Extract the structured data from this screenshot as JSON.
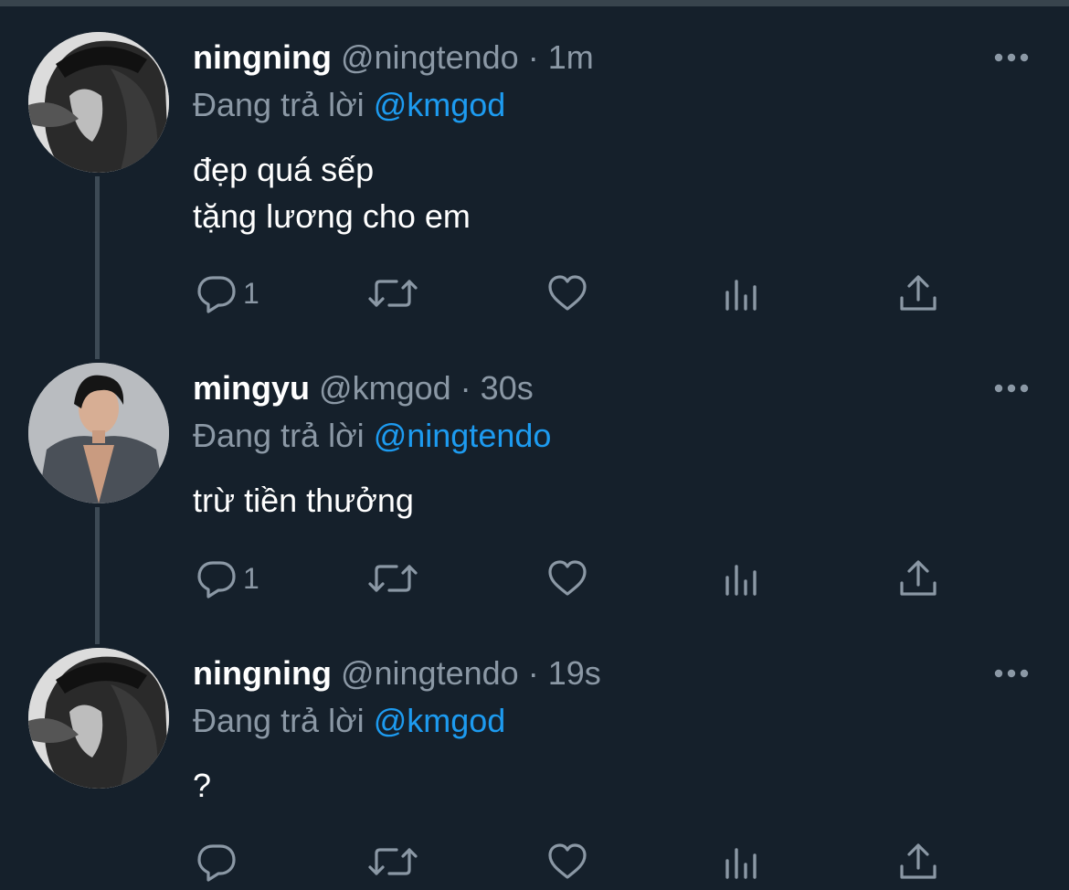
{
  "theme": {
    "background": "#15202b",
    "text": "#ffffff",
    "muted": "#8b98a5",
    "link": "#1d9bf0",
    "thread_line": "#3d4a55"
  },
  "tweets": [
    {
      "name": "ningning",
      "handle": "@ningtendo",
      "separator": "·",
      "time": "1m",
      "reply_prefix": "Đang trả lời",
      "reply_to": "@kmgod",
      "lines": [
        "đẹp quá sếp",
        "tặng lương cho em"
      ],
      "reply_count": "1",
      "avatar_icon": "user-avatar"
    },
    {
      "name": "mingyu",
      "handle": "@kmgod",
      "separator": "·",
      "time": "30s",
      "reply_prefix": "Đang trả lời",
      "reply_to": "@ningtendo",
      "lines": [
        "trừ tiền thưởng"
      ],
      "reply_count": "1",
      "avatar_icon": "user-avatar"
    },
    {
      "name": "ningning",
      "handle": "@ningtendo",
      "separator": "·",
      "time": "19s",
      "reply_prefix": "Đang trả lời",
      "reply_to": "@kmgod",
      "lines": [
        "?"
      ],
      "reply_count": "",
      "avatar_icon": "user-avatar"
    }
  ],
  "action_icons": [
    "reply-icon",
    "retweet-icon",
    "like-icon",
    "analytics-icon",
    "share-icon"
  ],
  "more_icon": "more-options-icon"
}
